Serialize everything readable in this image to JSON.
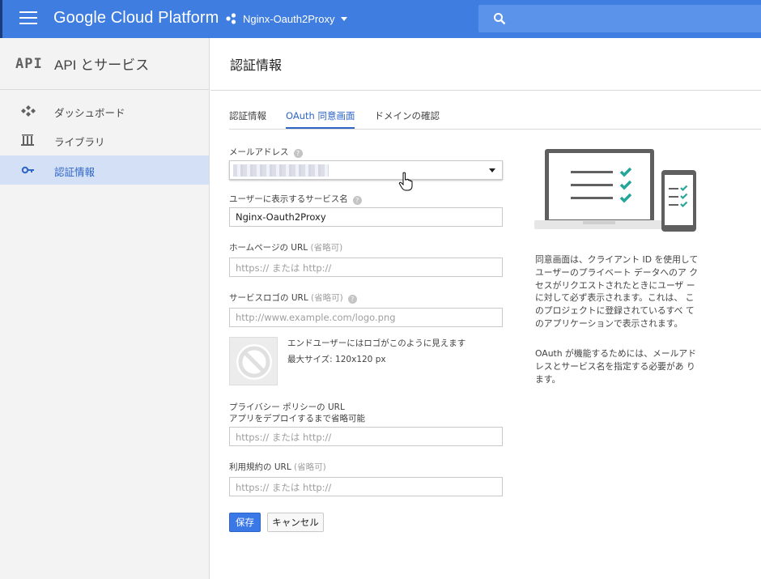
{
  "header": {
    "brand": "Google Cloud Platform",
    "project_name": "Nginx-Oauth2Proxy",
    "colors": {
      "bar": "#3f7de0",
      "search": "#5b93ea"
    }
  },
  "sidebar": {
    "badge": "API",
    "title": "API とサービス",
    "items": [
      {
        "label": "ダッシュボード",
        "icon": "dashboard-icon"
      },
      {
        "label": "ライブラリ",
        "icon": "library-icon"
      },
      {
        "label": "認証情報",
        "icon": "key-icon",
        "active": true
      }
    ]
  },
  "main": {
    "title": "認証情報",
    "tabs": [
      {
        "label": "認証情報"
      },
      {
        "label": "OAuth 同意画面",
        "active": true
      },
      {
        "label": "ドメインの確認"
      }
    ],
    "form": {
      "email_label": "メールアドレス",
      "service_name_label": "ユーザーに表示するサービス名",
      "service_name_value": "Nginx-Oauth2Proxy",
      "homepage_label": "ホームページの URL",
      "optional_marker": "(省略可)",
      "homepage_placeholder": "https:// または http://",
      "logo_label": "サービスロゴの URL",
      "logo_placeholder": "http://www.example.com/logo.png",
      "logo_note_1": "エンドユーザーにはロゴがこのように見えます",
      "logo_note_2": "最大サイズ: 120x120 px",
      "privacy_label": "プライバシー ポリシーの URL",
      "privacy_subnote": "アプリをデプロイするまで省略可能",
      "privacy_placeholder": "https:// または http://",
      "tos_label": "利用規約の URL",
      "tos_placeholder": "https:// または http://",
      "save": "保存",
      "cancel": "キャンセル"
    },
    "info": {
      "para1": "同意画面は、クライアント ID を使用して ユーザーのプライベート データへのア クセスがリクエストされたときにユーザ ーに対して必ず表示されます。これは、 このプロジェクトに登録されているすべ てのアプリケーションで表示されます。",
      "para2": "OAuth が機能するためには、メールアド レスとサービス名を指定する必要があ ります。"
    },
    "accent_color": "#2f66c6"
  }
}
